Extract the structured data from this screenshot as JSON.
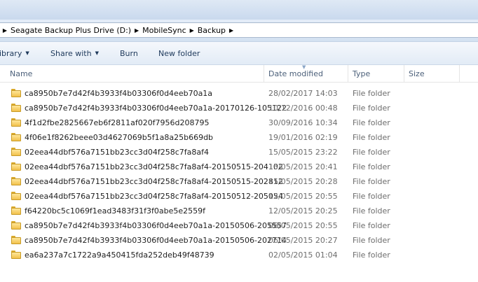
{
  "address": {
    "crumbs": [
      "Seagate Backup Plus Drive (D:)",
      "MobileSync",
      "Backup"
    ]
  },
  "toolbar": {
    "library_label": "ibrary",
    "share_label": "Share with",
    "burn_label": "Burn",
    "new_folder_label": "New folder"
  },
  "columns": {
    "name": "Name",
    "date": "Date modified",
    "type": "Type",
    "size": "Size"
  },
  "files": [
    {
      "name": "ca8950b7e7d42f4b3933f4b03306f0d4eeb70a1a",
      "date": "28/02/2017 14:03",
      "type": "File folder"
    },
    {
      "name": "ca8950b7e7d42f4b3933f4b03306f0d4eeb70a1a-20170126-105122",
      "date": "10/12/2016 00:48",
      "type": "File folder"
    },
    {
      "name": "4f1d2fbe2825667eb6f2811af020f7956d208795",
      "date": "30/09/2016 10:34",
      "type": "File folder"
    },
    {
      "name": "4f06e1f8262beee03d4627069b5f1a8a25b669db",
      "date": "19/01/2016 02:19",
      "type": "File folder"
    },
    {
      "name": "02eea44dbf576a7151bb23cc3d04f258c7fa8af4",
      "date": "15/05/2015 23:22",
      "type": "File folder"
    },
    {
      "name": "02eea44dbf576a7151bb23cc3d04f258c7fa8af4-20150515-204102",
      "date": "15/05/2015 20:41",
      "type": "File folder"
    },
    {
      "name": "02eea44dbf576a7151bb23cc3d04f258c7fa8af4-20150515-202812",
      "date": "15/05/2015 20:28",
      "type": "File folder"
    },
    {
      "name": "02eea44dbf576a7151bb23cc3d04f258c7fa8af4-20150512-205054",
      "date": "12/05/2015 20:55",
      "type": "File folder"
    },
    {
      "name": "f64220bc5c1069f1ead3483f31f3f0abe5e2559f",
      "date": "12/05/2015 20:25",
      "type": "File folder"
    },
    {
      "name": "ca8950b7e7d42f4b3933f4b03306f0d4eeb70a1a-20150506-205557",
      "date": "06/05/2015 20:55",
      "type": "File folder"
    },
    {
      "name": "ca8950b7e7d42f4b3933f4b03306f0d4eeb70a1a-20150506-202714",
      "date": "06/05/2015 20:27",
      "type": "File folder"
    },
    {
      "name": "ea6a237a7c1722a9a450415fda252deb49f48739",
      "date": "02/05/2015 01:04",
      "type": "File folder"
    }
  ]
}
